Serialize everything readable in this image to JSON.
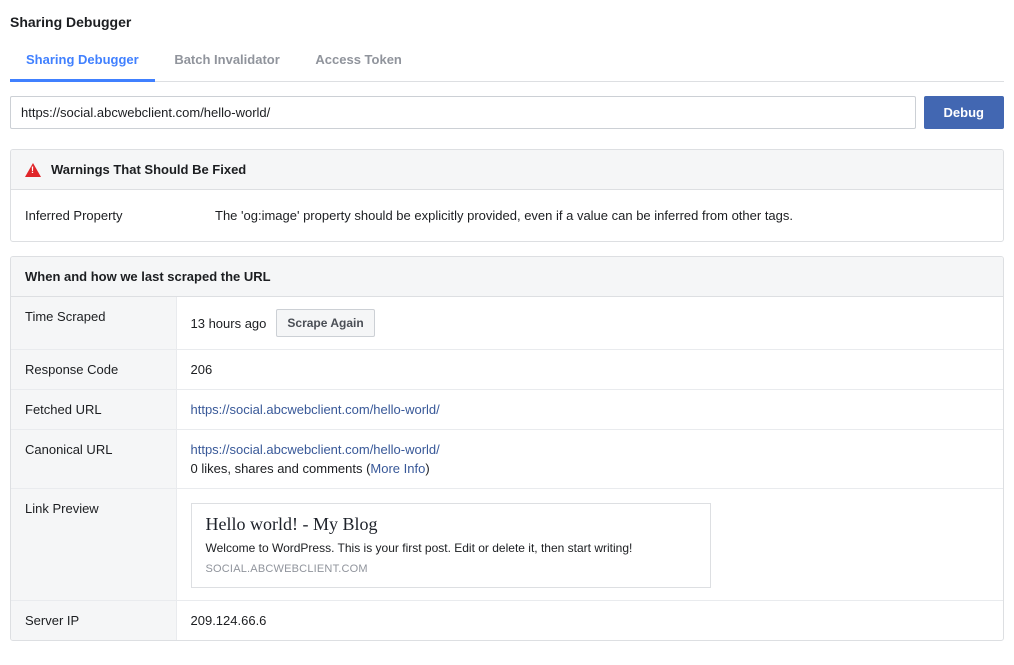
{
  "page": {
    "title": "Sharing Debugger"
  },
  "tabs": {
    "sharing": "Sharing Debugger",
    "batch": "Batch Invalidator",
    "access": "Access Token"
  },
  "url_input": {
    "value": "https://social.abcwebclient.com/hello-world/"
  },
  "buttons": {
    "debug": "Debug",
    "scrape_again": "Scrape Again"
  },
  "warnings": {
    "header": "Warnings That Should Be Fixed",
    "item_label": "Inferred Property",
    "item_text": "The 'og:image' property should be explicitly provided, even if a value can be inferred from other tags."
  },
  "scrape": {
    "header": "When and how we last scraped the URL",
    "rows": {
      "time_scraped_label": "Time Scraped",
      "time_scraped_value": "13 hours ago",
      "response_label": "Response Code",
      "response_value": "206",
      "fetched_label": "Fetched URL",
      "fetched_value": "https://social.abcwebclient.com/hello-world/",
      "canonical_label": "Canonical URL",
      "canonical_value": "https://social.abcwebclient.com/hello-world/",
      "canonical_stats_prefix": "0 likes, shares and comments (",
      "canonical_stats_link": "More Info",
      "canonical_stats_suffix": ")",
      "preview_label": "Link Preview",
      "server_ip_label": "Server IP",
      "server_ip_value": "209.124.66.6"
    }
  },
  "preview": {
    "title": "Hello world! - My Blog",
    "description": "Welcome to WordPress. This is your first post. Edit or delete it, then start writing!",
    "domain": "SOCIAL.ABCWEBCLIENT.COM"
  }
}
